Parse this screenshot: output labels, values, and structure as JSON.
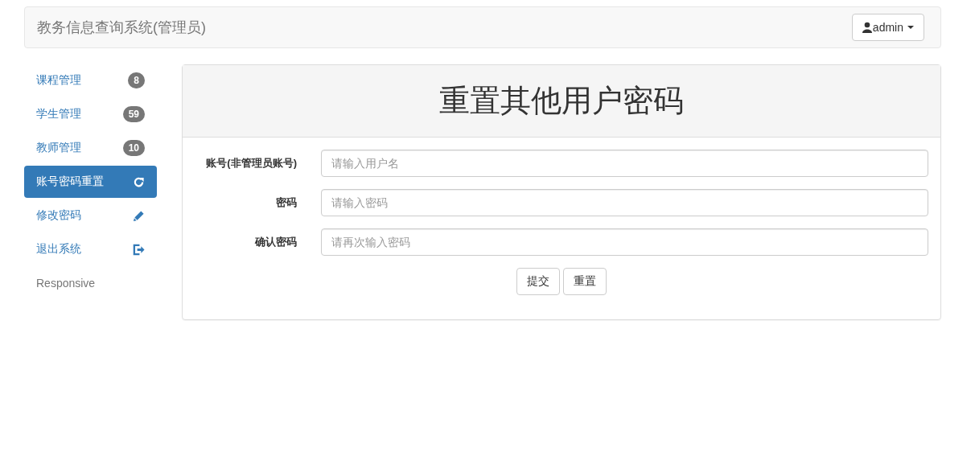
{
  "navbar": {
    "brand": "教务信息查询系统(管理员)",
    "user_menu": "admin"
  },
  "sidebar": {
    "items": [
      {
        "label": "课程管理",
        "kind": "badge",
        "badge": "8",
        "selected": false
      },
      {
        "label": "学生管理",
        "kind": "badge",
        "badge": "59",
        "selected": false
      },
      {
        "label": "教师管理",
        "kind": "badge",
        "badge": "10",
        "selected": false
      },
      {
        "label": "账号密码重置",
        "kind": "refresh",
        "selected": true
      },
      {
        "label": "修改密码",
        "kind": "edit",
        "selected": false
      },
      {
        "label": "退出系统",
        "kind": "logout",
        "selected": false
      },
      {
        "label": "Responsive",
        "kind": "plain",
        "selected": false
      }
    ]
  },
  "panel": {
    "title": "重置其他用户密码",
    "fields": [
      {
        "label": "账号(非管理员账号)",
        "placeholder": "请输入用户名"
      },
      {
        "label": "密码",
        "placeholder": "请输入密码"
      },
      {
        "label": "确认密码",
        "placeholder": "请再次输入密码"
      }
    ],
    "buttons": [
      "提交",
      "重置"
    ]
  }
}
